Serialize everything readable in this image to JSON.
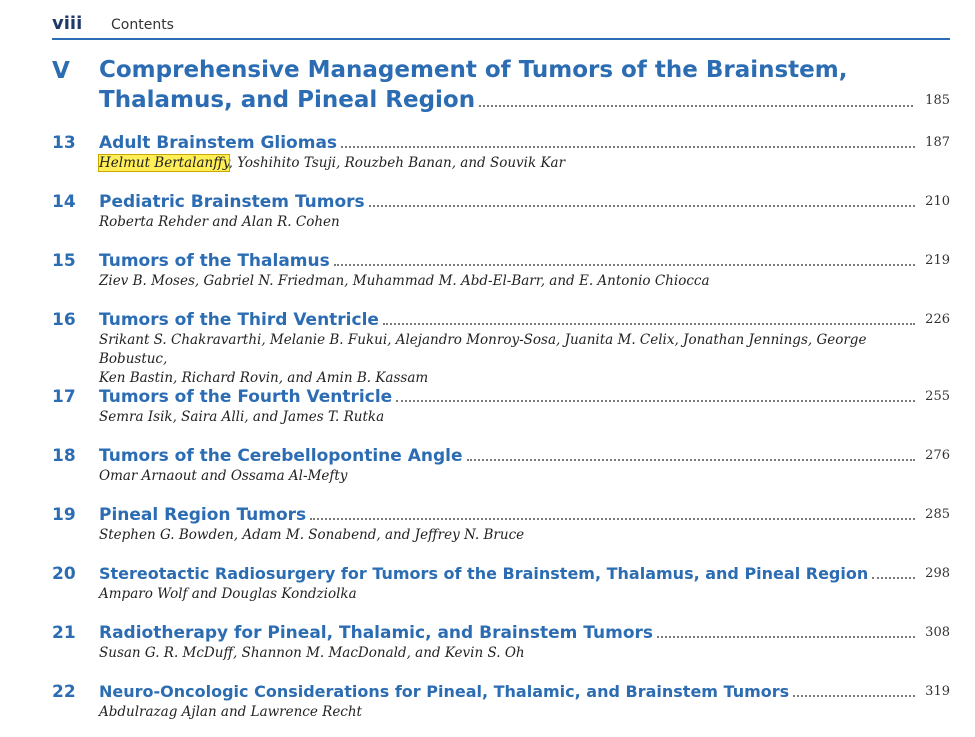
{
  "header": {
    "page_number": "viii",
    "section": "Contents"
  },
  "part": {
    "number": "V",
    "title_line1": "Comprehensive Management of Tumors of the Brainstem,",
    "title_line2": "Thalamus, and Pineal Region",
    "page": "185"
  },
  "chapters": [
    {
      "number": "13",
      "title": "Adult Brainstem Gliomas",
      "page": "187",
      "authors_highlight": "Helmut Bertalanffy",
      "authors": ", Yoshihito Tsuji, Rouzbeh Banan, and Souvik Kar"
    },
    {
      "number": "14",
      "title": "Pediatric Brainstem Tumors",
      "page": "210",
      "authors": "Roberta Rehder and Alan R. Cohen"
    },
    {
      "number": "15",
      "title": "Tumors of the Thalamus",
      "page": "219",
      "authors": "Ziev B. Moses, Gabriel N. Friedman, Muhammad M. Abd-El-Barr, and E. Antonio Chiocca"
    },
    {
      "number": "16",
      "title": "Tumors of the Third Ventricle",
      "page": "226",
      "authors_line1": "Srikant S. Chakravarthi, Melanie B. Fukui, Alejandro Monroy-Sosa, Juanita M. Celix, Jonathan Jennings, George Bobustuc,",
      "authors_line2": "Ken Bastin, Richard Rovin, and Amin B. Kassam"
    },
    {
      "number": "17",
      "title": "Tumors of the Fourth Ventricle",
      "page": "255",
      "authors": "Semra Isik, Saira Alli, and James T. Rutka"
    },
    {
      "number": "18",
      "title": "Tumors of the Cerebellopontine Angle",
      "page": "276",
      "authors": "Omar Arnaout and Ossama Al-Mefty"
    },
    {
      "number": "19",
      "title": "Pineal Region Tumors",
      "page": "285",
      "authors": "Stephen G. Bowden, Adam M. Sonabend, and Jeffrey N. Bruce"
    },
    {
      "number": "20",
      "title": "Stereotactic Radiosurgery for Tumors of the Brainstem, Thalamus, and Pineal Region",
      "page": "298",
      "authors": "Amparo Wolf and Douglas Kondziolka"
    },
    {
      "number": "21",
      "title": "Radiotherapy for Pineal, Thalamic, and Brainstem Tumors",
      "page": "308",
      "authors": "Susan G. R. McDuff, Shannon M. MacDonald, and Kevin S. Oh"
    },
    {
      "number": "22",
      "title": "Neuro-Oncologic Considerations for Pineal, Thalamic, and Brainstem Tumors",
      "page": "319",
      "authors": "Abdulrazag Ajlan and Lawrence Recht"
    }
  ],
  "colors": {
    "accent": "#2b6cb3",
    "highlight": "#ffee55"
  }
}
